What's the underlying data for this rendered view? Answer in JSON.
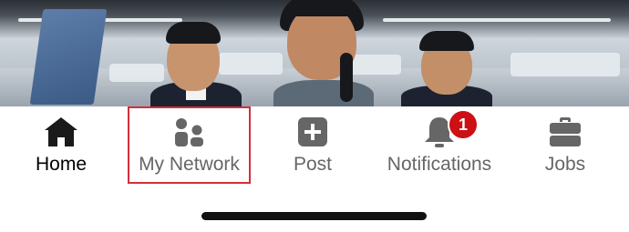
{
  "tabs": [
    {
      "id": "home",
      "label": "Home",
      "icon": "home-icon",
      "active": true
    },
    {
      "id": "my-network",
      "label": "My Network",
      "icon": "people-icon",
      "active": false
    },
    {
      "id": "post",
      "label": "Post",
      "icon": "plus-square-icon",
      "active": false
    },
    {
      "id": "notifications",
      "label": "Notifications",
      "icon": "bell-icon",
      "active": false,
      "badge": "1"
    },
    {
      "id": "jobs",
      "label": "Jobs",
      "icon": "briefcase-icon",
      "active": false
    }
  ],
  "colors": {
    "active": "#000000",
    "inactive": "#666666",
    "icon_inactive": "#666666",
    "badge": "#cc1016",
    "highlight_box": "#d32f3a"
  }
}
